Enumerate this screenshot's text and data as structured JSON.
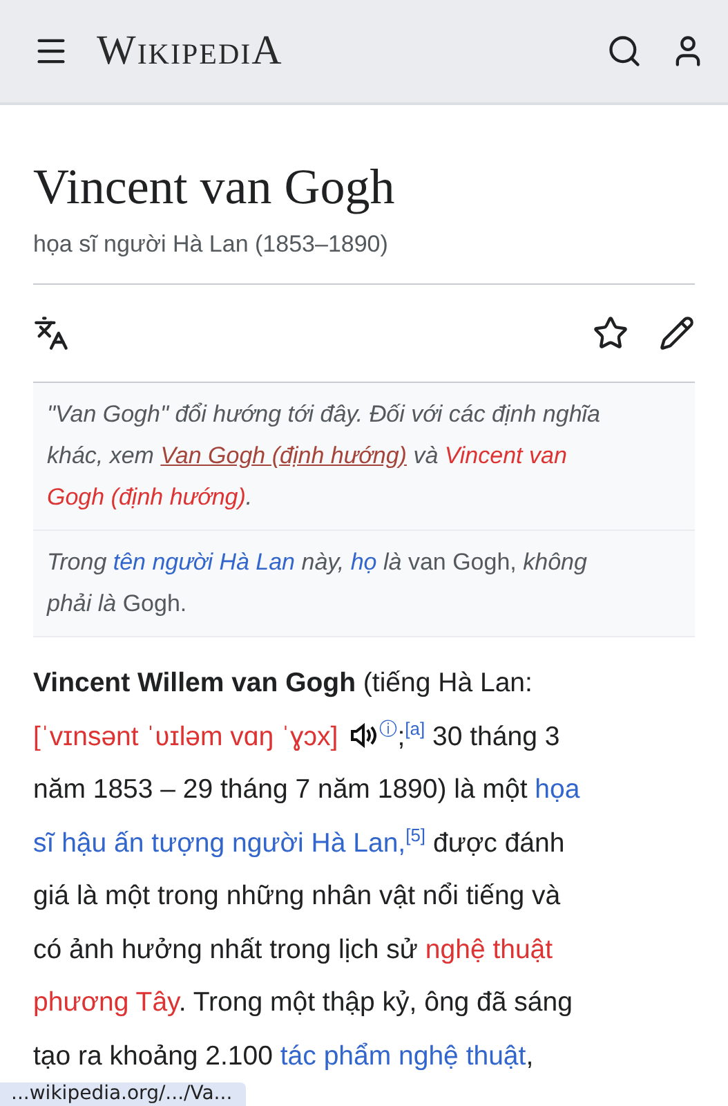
{
  "header": {
    "logo": "WikipediA"
  },
  "title": "Vincent van Gogh",
  "subtitle": "họa sĩ người Hà Lan (1853–1890)",
  "hatnotes": [
    [
      [
        {
          "kind": "text",
          "text": "\"Van Gogh\" đổi hướng tới đây. Đối với các định nghĩa"
        }
      ],
      [
        {
          "kind": "text",
          "text": "khác, xem "
        },
        {
          "kind": "hover",
          "text": "Van Gogh (định hướng)"
        },
        {
          "kind": "text",
          "text": " và "
        },
        {
          "kind": "redlink",
          "text": "Vincent van"
        }
      ],
      [
        {
          "kind": "redlink",
          "text": "Gogh (định hướng)"
        },
        {
          "kind": "text",
          "text": "."
        }
      ]
    ],
    [
      [
        {
          "kind": "text",
          "text": "Trong "
        },
        {
          "kind": "link",
          "text": "tên người Hà Lan"
        },
        {
          "kind": "text",
          "text": " này, "
        },
        {
          "kind": "link",
          "text": "họ"
        },
        {
          "kind": "text",
          "text": " là "
        },
        {
          "kind": "upright",
          "text": "van Gogh,"
        },
        {
          "kind": "text",
          "text": " không"
        }
      ],
      [
        {
          "kind": "text",
          "text": "phải là "
        },
        {
          "kind": "upright",
          "text": "Gogh."
        }
      ]
    ]
  ],
  "lead": [
    [
      {
        "kind": "bold",
        "text": "Vincent Willem van Gogh"
      },
      {
        "kind": "text",
        "text": " (tiếng Hà Lan:"
      }
    ],
    [
      {
        "kind": "redlink",
        "text": "[ˈvɪnsənt ˈʋɪləm vɑŋ ˈɣɔx]"
      },
      {
        "kind": "audio"
      },
      {
        "kind": "sup",
        "text": "ⓘ"
      },
      {
        "kind": "text",
        "text": ";"
      },
      {
        "kind": "sup",
        "text": "[a]"
      },
      {
        "kind": "text",
        "text": " 30 tháng 3"
      }
    ],
    [
      {
        "kind": "text",
        "text": "năm 1853 – 29 tháng 7 năm 1890) là một "
      },
      {
        "kind": "link",
        "text": "họa"
      }
    ],
    [
      {
        "kind": "link",
        "text": "sĩ hậu ấn tượng người Hà Lan,"
      },
      {
        "kind": "sup",
        "text": "[5]"
      },
      {
        "kind": "text",
        "text": " được đánh"
      }
    ],
    [
      {
        "kind": "text",
        "text": "giá là một trong những nhân vật nổi tiếng và"
      }
    ],
    [
      {
        "kind": "text",
        "text": "có ảnh hưởng nhất trong lịch sử "
      },
      {
        "kind": "redlink",
        "text": "nghệ thuật"
      }
    ],
    [
      {
        "kind": "redlink",
        "text": "phương Tây"
      },
      {
        "kind": "text",
        "text": ". Trong một thập kỷ, ông đã sáng"
      }
    ],
    [
      {
        "kind": "text",
        "text": "tạo ra khoảng 2.100 "
      },
      {
        "kind": "link",
        "text": "tác phẩm nghệ thuật"
      },
      {
        "kind": "text",
        "text": ","
      }
    ]
  ],
  "status_url": "...wikipedia.org/.../Va..."
}
